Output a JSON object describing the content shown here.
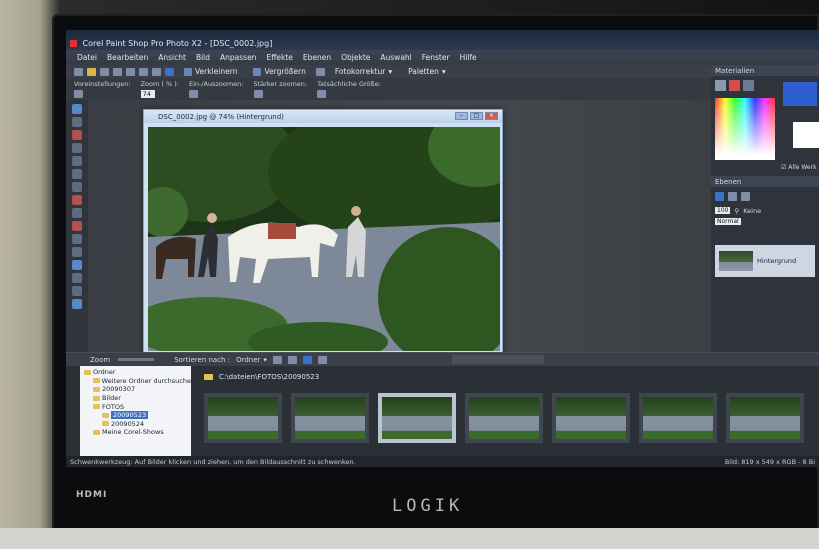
{
  "app": {
    "title": "Corel Paint Shop Pro Photo X2 - [DSC_0002.jpg]",
    "menu": [
      "Datei",
      "Bearbeiten",
      "Ansicht",
      "Bild",
      "Anpassen",
      "Effekte",
      "Ebenen",
      "Objekte",
      "Auswahl",
      "Fenster",
      "Hilfe"
    ],
    "quick_tools": [
      "Verkleinern",
      "Vergrößern"
    ],
    "dropdowns": [
      "Fotokorrektur",
      "Paletten"
    ]
  },
  "options_bar": {
    "presets_label": "Voreinstellungen:",
    "zoom_label": "Zoom ( % ):",
    "zoom_value": "74",
    "zoom_inout_label": "Ein-/Auszoomen:",
    "zoom_more_label": "Stärker zoomen:",
    "actual_size_label": "Tatsächliche Größe:"
  },
  "image_window": {
    "title": "DSC_0002.jpg @  74% (Hintergrund)"
  },
  "materials": {
    "title": "Materialien",
    "all_tools": "Alle Werk",
    "fg_color": "#2e5fd0",
    "bg_color": "#ffffff"
  },
  "layers": {
    "title": "Ebenen",
    "opacity": "100",
    "mode": "Normal",
    "none_label": "Keine",
    "items": [
      {
        "label": "Hintergrund"
      }
    ]
  },
  "organizer": {
    "zoom_label": "Zoom",
    "sort_label": "Sortieren nach :",
    "sort_value": "Ordner",
    "path": "C:\\dateien\\FOTOS\\20090523",
    "tree": [
      {
        "label": "Ordner",
        "indent": 0
      },
      {
        "label": "Weitere Ordner durchsuche",
        "indent": 1
      },
      {
        "label": "20090307",
        "indent": 1
      },
      {
        "label": "Bilder",
        "indent": 1
      },
      {
        "label": "FOTOS",
        "indent": 1
      },
      {
        "label": "20090523",
        "indent": 2,
        "selected": true
      },
      {
        "label": "20090524",
        "indent": 2
      },
      {
        "label": "Meine Corel-Shows",
        "indent": 1
      }
    ],
    "thumbnails_count_visible": 7
  },
  "status": {
    "hint": "Schwenkwerkzeug: Auf Bilder klicken und ziehen, um den Bildausschnitt zu schwenken.",
    "image_info": "Bild:  819 x 549 x RGB - 8 Bi"
  },
  "device": {
    "hdmi_label": "HDMI",
    "brand": "LOGIK"
  }
}
